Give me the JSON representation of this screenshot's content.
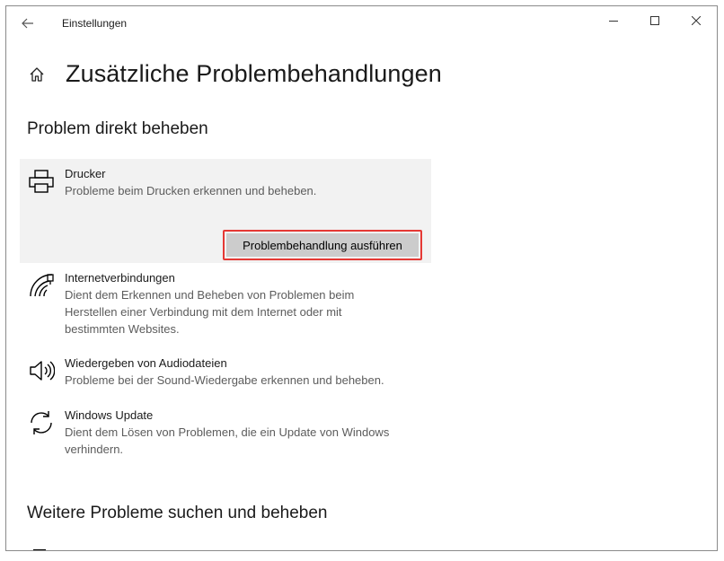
{
  "window": {
    "title": "Einstellungen"
  },
  "header": {
    "title": "Zusätzliche Problembehandlungen"
  },
  "sections": {
    "direct": "Problem direkt beheben",
    "more": "Weitere Probleme suchen und beheben"
  },
  "items": [
    {
      "title": "Drucker",
      "description": "Probleme beim Drucken erkennen und beheben.",
      "icon": "printer-icon",
      "button": "Problembehandlung ausführen"
    },
    {
      "title": "Internetverbindungen",
      "description": "Dient dem Erkennen und Beheben von Problemen beim Herstellen einer Verbindung mit dem Internet oder mit bestimmten Websites.",
      "icon": "wifi-icon"
    },
    {
      "title": "Wiedergeben von Audiodateien",
      "description": "Probleme bei der Sound-Wiedergabe erkennen und beheben.",
      "icon": "speaker-icon"
    },
    {
      "title": "Windows Update",
      "description": "Dient dem Lösen von Problemen, die ein Update von Windows verhindern.",
      "icon": "sync-icon"
    }
  ],
  "colors": {
    "highlight_border": "#e53935",
    "selected_bg": "#f2f2f2",
    "button_bg": "#cccccc"
  }
}
